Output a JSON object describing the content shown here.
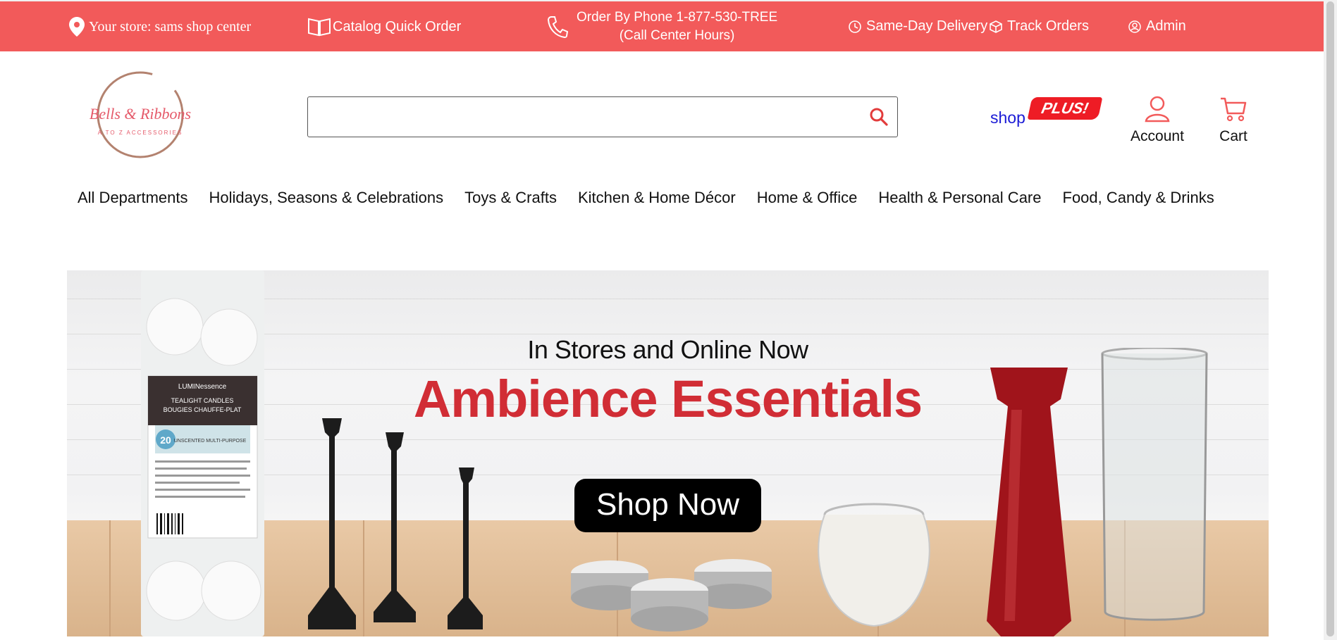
{
  "topbar": {
    "store_label": "Your store: sams shop center",
    "catalog_label": "Catalog Quick Order",
    "phone_line1": "Order By Phone 1-877-530-TREE",
    "phone_line2": "(Call Center Hours)",
    "delivery_label": "Same-Day Delivery",
    "track_label": "Track Orders",
    "admin_label": "Admin",
    "bg_color": "#f25a5a"
  },
  "header": {
    "logo_text": "Bells & Ribbons",
    "logo_tagline": "A TO Z ACCESSORIES",
    "search_placeholder": "",
    "shop_label": "shop",
    "plus_label": "PLUS!",
    "account_label": "Account",
    "cart_label": "Cart"
  },
  "nav": {
    "categories": [
      "All Departments",
      "Holidays, Seasons & Celebrations",
      "Toys & Crafts",
      "Kitchen & Home Décor",
      "Home & Office",
      "Health & Personal Care",
      "Food, Candy & Drinks"
    ]
  },
  "hero": {
    "subtitle": "In Stores and Online Now",
    "title": "Ambience Essentials",
    "button_label": "Shop Now",
    "product_brand": "LUMINessence",
    "product_name": "TEALIGHT CANDLES",
    "product_name_fr": "BOUGIES CHAUFFE-PLAT",
    "product_count": "20",
    "product_desc": "UNSCENTED MULTI-PURPOSE",
    "title_color": "#d12d35"
  },
  "icons": {
    "store": "map-pin-icon",
    "catalog": "book-icon",
    "phone": "phone-icon",
    "delivery": "clock-icon",
    "track": "box-icon",
    "admin": "user-circle-icon",
    "search": "search-icon",
    "account": "user-icon",
    "cart": "cart-icon"
  }
}
